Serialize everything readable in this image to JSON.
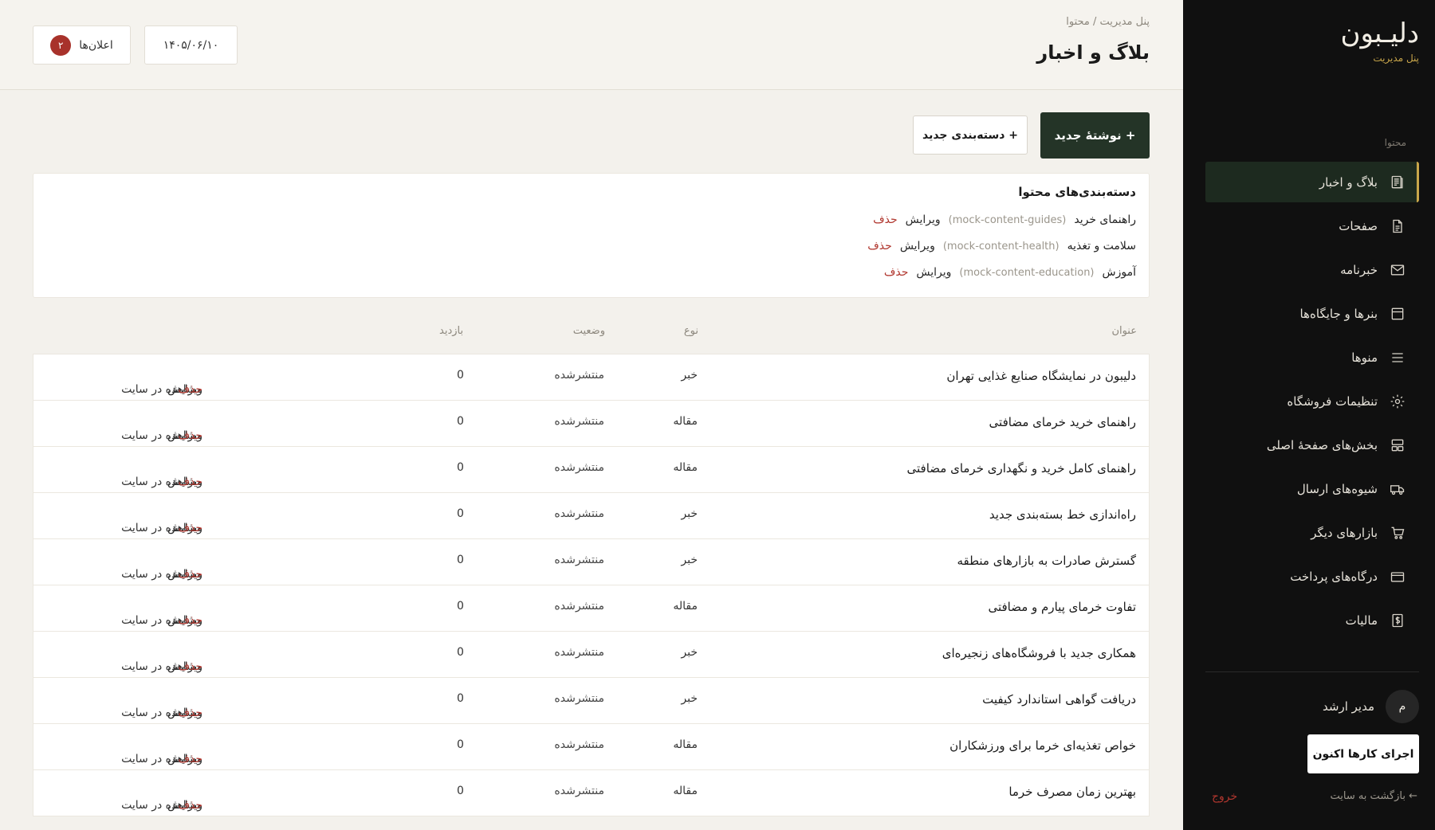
{
  "header": {
    "breadcrumb": "پنل مدیریت / محتوا",
    "title": "بلاگ و اخبار",
    "date": "۱۴۰۵/۰۶/۱۰",
    "announcements_label": "اعلان‌ها",
    "announcements_count": "۲"
  },
  "actions": {
    "new_post": "+ نوشتهٔ جدید",
    "new_category": "+ دسته‌بندی جدید"
  },
  "categories": {
    "title": "دسته‌بندی‌های محتوا",
    "items": [
      {
        "name": "راهنمای خرید",
        "slug": "(mock-content-guides)",
        "edit": "ویرایش",
        "delete": "حذف"
      },
      {
        "name": "سلامت و تغذیه",
        "slug": "(mock-content-health)",
        "edit": "ویرایش",
        "delete": "حذف"
      },
      {
        "name": "آموزش",
        "slug": "(mock-content-education)",
        "edit": "ویرایش",
        "delete": "حذف"
      }
    ]
  },
  "table": {
    "columns": {
      "title": "عنوان",
      "type": "نوع",
      "status": "وضعیت",
      "views": "بازدید"
    },
    "action_labels": {
      "edit": "ویرایش",
      "view": "مشاهده در سایت",
      "delete": "حذف"
    },
    "rows": [
      {
        "title": "دلیبون در نمایشگاه صنایع غذایی تهران",
        "type": "خبر",
        "status": "منتشرشده",
        "views": "0"
      },
      {
        "title": "راهنمای خرید خرمای مضافتی",
        "type": "مقاله",
        "status": "منتشرشده",
        "views": "0"
      },
      {
        "title": "راهنمای کامل خرید و نگهداری خرمای مضافتی",
        "type": "مقاله",
        "status": "منتشرشده",
        "views": "0"
      },
      {
        "title": "راه‌اندازی خط بسته‌بندی جدید",
        "type": "خبر",
        "status": "منتشرشده",
        "views": "0"
      },
      {
        "title": "گسترش صادرات به بازارهای منطقه",
        "type": "خبر",
        "status": "منتشرشده",
        "views": "0"
      },
      {
        "title": "تفاوت خرمای پیارم و مضافتی",
        "type": "مقاله",
        "status": "منتشرشده",
        "views": "0"
      },
      {
        "title": "همکاری جدید با فروشگاه‌های زنجیره‌ای",
        "type": "خبر",
        "status": "منتشرشده",
        "views": "0"
      },
      {
        "title": "دریافت گواهی استاندارد کیفیت",
        "type": "خبر",
        "status": "منتشرشده",
        "views": "0"
      },
      {
        "title": "خواص تغذیه‌ای خرما برای ورزشکاران",
        "type": "مقاله",
        "status": "منتشرشده",
        "views": "0"
      },
      {
        "title": "بهترین زمان مصرف خرما",
        "type": "مقاله",
        "status": "منتشرشده",
        "views": "0"
      }
    ]
  },
  "sidebar": {
    "logo": "دلیـبون",
    "logo_sub": "پنل مدیریت",
    "section_label": "محتوا",
    "items": [
      {
        "label": "بلاگ و اخبار",
        "icon": "blog-icon"
      },
      {
        "label": "صفحات",
        "icon": "page-icon"
      },
      {
        "label": "خبرنامه",
        "icon": "mail-icon"
      },
      {
        "label": "بنرها و جایگاه‌ها",
        "icon": "banner-icon"
      },
      {
        "label": "منوها",
        "icon": "menu-icon"
      },
      {
        "label": "تنظیمات فروشگاه",
        "icon": "gear-icon"
      },
      {
        "label": "بخش‌های صفحهٔ اصلی",
        "icon": "layout-icon"
      },
      {
        "label": "شیوه‌های ارسال",
        "icon": "truck-icon"
      },
      {
        "label": "بازارهای دیگر",
        "icon": "cart-icon"
      },
      {
        "label": "درگاه‌های پرداخت",
        "icon": "card-icon"
      },
      {
        "label": "مالیات",
        "icon": "tax-icon"
      }
    ],
    "user": {
      "initial": "م",
      "name": "مدیر ارشد"
    },
    "run_button": "اجرای کارها اکنون",
    "back_link": "← بازگشت به سایت",
    "logout": "خروج"
  },
  "colors": {
    "accent": "#243427",
    "gold": "#c9a64a",
    "danger": "#b0362e",
    "sidebar_bg": "#101010"
  }
}
